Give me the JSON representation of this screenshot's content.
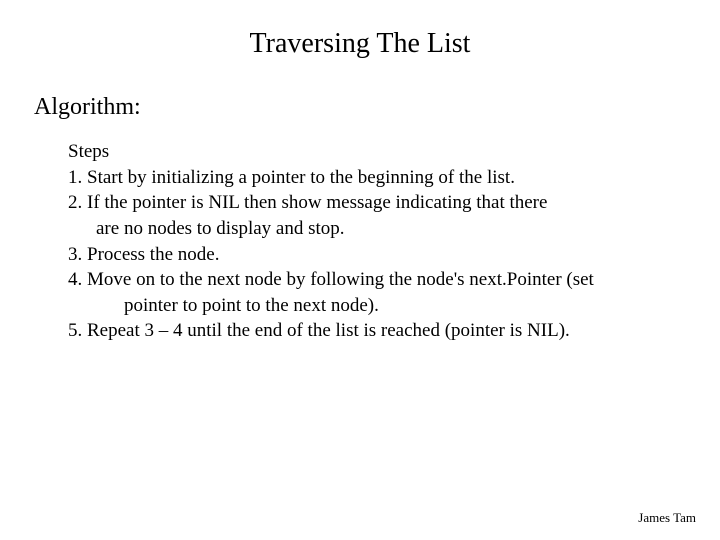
{
  "title": "Traversing The List",
  "section_heading": "Algorithm:",
  "steps_label": "Steps",
  "steps": {
    "s1": "1. Start by initializing a pointer to the beginning of the list.",
    "s2": "2. If the pointer is NIL then show message indicating that there",
    "s2b": "are no nodes to display and stop.",
    "s3": "3. Process the node.",
    "s4": "4. Move on to the next node by following the node's next.Pointer (set",
    "s4b": "pointer to point to the next node).",
    "s5": "5. Repeat 3 – 4 until the end of the list is reached (pointer is NIL)."
  },
  "author": "James Tam"
}
